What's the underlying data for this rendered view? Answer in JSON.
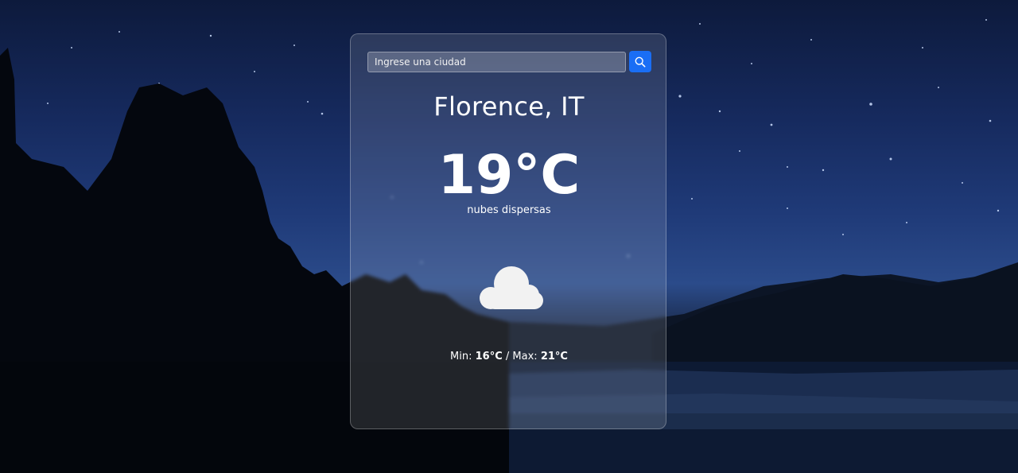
{
  "search": {
    "placeholder": "Ingrese una ciudad",
    "button_icon": "search-icon"
  },
  "weather": {
    "city": "Florence, IT",
    "temperature": "19°C",
    "description": "nubes dispersas",
    "icon": "cloud-icon",
    "min_label": "Min:",
    "min_value": "16°C",
    "separator": "/",
    "max_label": "Max:",
    "max_value": "21°C"
  },
  "colors": {
    "accent": "#1a6ef5",
    "text": "#ffffff",
    "cloud": "#f2f2f2"
  }
}
